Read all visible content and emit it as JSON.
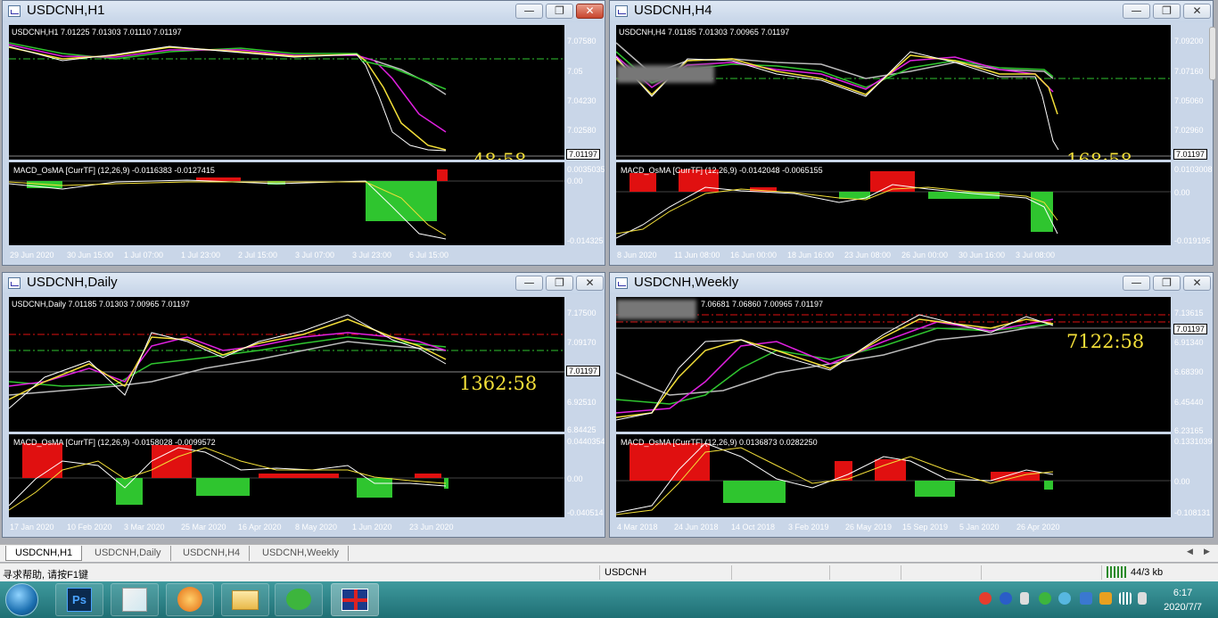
{
  "windows": [
    {
      "title": "USDCNH,H1",
      "info": "USDCNH,H1  7.01225 7.01303 7.01110 7.01197",
      "price_scale": [
        "7.07580",
        "7.05",
        "7.04230",
        "7.02580",
        "7.01197"
      ],
      "timer": "48:58",
      "macd_info": "MACD_OsMA [CurrTF] (12,26,9) -0.0116383 -0.0127415",
      "macd_scale": [
        "0.0035035",
        "0.00",
        "-0.014325"
      ],
      "time_ticks": [
        "29 Jun 2020",
        "30 Jun 15:00",
        "1 Jul 07:00",
        "1 Jul 23:00",
        "2 Jul 15:00",
        "3 Jul 07:00",
        "3 Jul 23:00",
        "6 Jul 15:00"
      ]
    },
    {
      "title": "USDCNH,H4",
      "info": "USDCNH,H4  7.01185 7.01303 7.00965 7.01197",
      "price_scale": [
        "7.09200",
        "7.07160",
        "7.05060",
        "7.02960",
        "7.01197"
      ],
      "timer": "168:58",
      "macd_info": "MACD_OsMA [CurrTF] (12,26,9) -0.0142048 -0.0065155",
      "macd_scale": [
        "0.0103008",
        "0.00",
        "-0.019195"
      ],
      "time_ticks": [
        "8 Jun 2020",
        "11 Jun 08:00",
        "16 Jun 00:00",
        "18 Jun 16:00",
        "23 Jun 08:00",
        "26 Jun 00:00",
        "30 Jun 16:00",
        "3 Jul 08:00"
      ]
    },
    {
      "title": "USDCNH,Daily",
      "info": "USDCNH,Daily  7.01185 7.01303 7.00965 7.01197",
      "price_scale": [
        "7.17500",
        "7.09170",
        "7.01197",
        "6.92510",
        "6.84425"
      ],
      "timer": "1362:58",
      "macd_info": "MACD_OsMA [CurrTF] (12,26,9) -0.0158028 -0.0099572",
      "macd_scale": [
        "0.0440354",
        "0.00",
        "-0.040514"
      ],
      "time_ticks": [
        "17 Jan 2020",
        "10 Feb 2020",
        "3 Mar 2020",
        "25 Mar 2020",
        "16 Apr 2020",
        "8 May 2020",
        "1 Jun 2020",
        "23 Jun 2020"
      ]
    },
    {
      "title": "USDCNH,Weekly",
      "info": "7.06681 7.06860 7.00965 7.01197",
      "price_scale": [
        "7.13615",
        "7.01197",
        "6.91340",
        "6.68390",
        "6.45440",
        "6.23165"
      ],
      "timer": "7122:58",
      "macd_info": "MACD_OsMA [CurrTF] (12,26,9) 0.0136873 0.0282250",
      "macd_scale": [
        "0.1331039",
        "0.00",
        "-0.108131"
      ],
      "time_ticks": [
        "4 Mar 2018",
        "24 Jun 2018",
        "14 Oct 2018",
        "3 Feb 2019",
        "26 May 2019",
        "15 Sep 2019",
        "5 Jan 2020",
        "26 Apr 2020"
      ]
    }
  ],
  "tabs": [
    "USDCNH,H1",
    "USDCNH,Daily",
    "USDCNH,H4",
    "USDCNH,Weekly"
  ],
  "status": {
    "help": "寻求帮助, 请按F1键",
    "symbol": "USDCNH",
    "traffic": "44/3 kb"
  },
  "clock": {
    "time": "6:17",
    "date": "2020/7/7"
  },
  "colors": {
    "bull": "#e01010",
    "bear": "#22c022",
    "ma_fast": "#ffffff",
    "ma_mid": "#f3df39",
    "ma_slow": "#e020e0",
    "ma_green": "#2fc52f",
    "ma_gray": "#bbbbbb",
    "timer": "#f3df39"
  },
  "taskbar_apps": [
    "start-orb-icon",
    "photoshop-icon",
    "paint-icon",
    "browser-icon",
    "folder-icon",
    "wechat-icon",
    "mt4-flag-icon"
  ]
}
